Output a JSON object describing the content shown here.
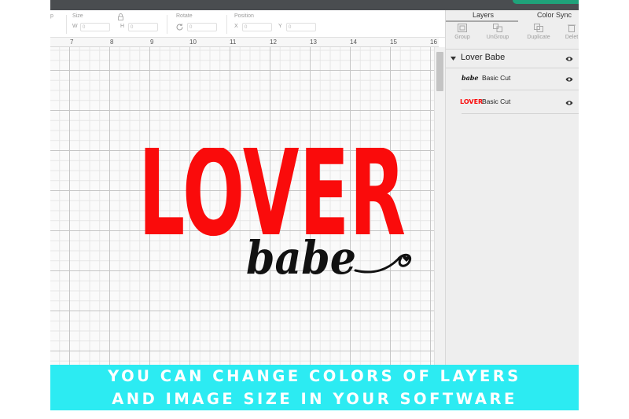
{
  "toolbar": {
    "partial_label": "p",
    "size_label": "Size",
    "width_letter": "W",
    "width_value": "0",
    "height_letter": "H",
    "height_value": "0",
    "rotate_label": "Rotate",
    "rotate_value": "0",
    "position_label": "Position",
    "x_letter": "X",
    "x_value": "0",
    "y_letter": "Y",
    "y_value": "0"
  },
  "ruler": {
    "marks": [
      "7",
      "8",
      "9",
      "10",
      "11",
      "12",
      "13",
      "14",
      "15",
      "16"
    ]
  },
  "design": {
    "word_main": "LOVER",
    "word_script": "babe",
    "main_color": "#fa0b0b",
    "script_color": "#111111"
  },
  "panel": {
    "tabs": {
      "layers": "Layers",
      "color_sync": "Color Sync"
    },
    "tools": {
      "group": "Group",
      "ungroup": "UnGroup",
      "duplicate": "Duplicate",
      "delete": "Delet"
    },
    "group_name": "Lover Babe",
    "layers": [
      {
        "thumb": "babe",
        "name": "Basic Cut",
        "thumb_color": "#111111",
        "icon": "eye-icon"
      },
      {
        "thumb": "LOVER",
        "name": "Basic Cut",
        "thumb_color": "#fa0b0b",
        "icon": "eye-icon"
      }
    ]
  },
  "banner": {
    "line1": "YOU CAN CHANGE COLORS OF LAYERS",
    "line2": "AND IMAGE SIZE IN YOUR SOFTWARE",
    "background": "#2cebf2"
  }
}
